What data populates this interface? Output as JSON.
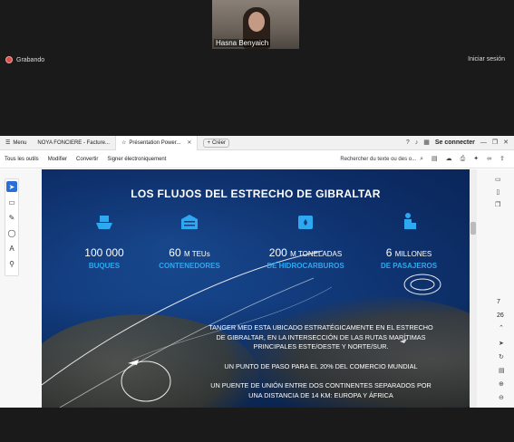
{
  "meeting": {
    "participant_name": "Hasna Benyaich",
    "recording_label": "Grabando",
    "signin_label": "Iniciar sesión"
  },
  "browser": {
    "menu_label": "Menu",
    "tabs": [
      {
        "label": "NOYA FONCIERE - Facture..."
      },
      {
        "label": "Présentation Power..."
      }
    ],
    "new_tab_label": "Créer",
    "connect_label": "Se connecter"
  },
  "toolbar": {
    "items": [
      "Tous les outils",
      "Modifier",
      "Convertir",
      "Signer électroniquement"
    ],
    "search_label": "Rechercher du texte ou des o..."
  },
  "viewer": {
    "page_current": "7",
    "page_total": "26"
  },
  "slide": {
    "title": "LOS FLUJOS DEL ESTRECHO DE GIBRALTAR",
    "stats": [
      {
        "number": "100 000",
        "suffix": "",
        "unit": "BUQUES",
        "icon": "ship-icon"
      },
      {
        "number": "60",
        "suffix": "M TEUs",
        "unit": "CONTENEDORES",
        "icon": "container-icon"
      },
      {
        "number": "200",
        "suffix": "M TONELADAS",
        "unit": "DE HIDROCARBUROS",
        "icon": "oil-barrel-icon"
      },
      {
        "number": "6",
        "suffix": "MILLONES",
        "unit": "DE PASAJEROS",
        "icon": "passenger-icon"
      }
    ],
    "paragraphs": [
      "TANGER MED ESTA UBICADO ESTRATÉGICAMENTE EN EL ESTRECHO DE GIBRALTAR, EN LA INTERSECCIÓN DE LAS RUTAS MARÍTIMAS PRINCIPALES ESTE/OESTE Y NORTE/SUR.",
      "UN PUNTO DE PASO PARA EL 20% DEL COMERCIO MUNDIAL",
      "UN PUENTE DE UNIÓN ENTRE DOS CONTINENTES SEPARADOS POR UNA DISTANCIA DE 14 KM: EUROPA Y ÁFRICA"
    ]
  },
  "colors": {
    "accent": "#2ea8f0",
    "slide_bg": "#123d80",
    "record": "#d9524a"
  }
}
